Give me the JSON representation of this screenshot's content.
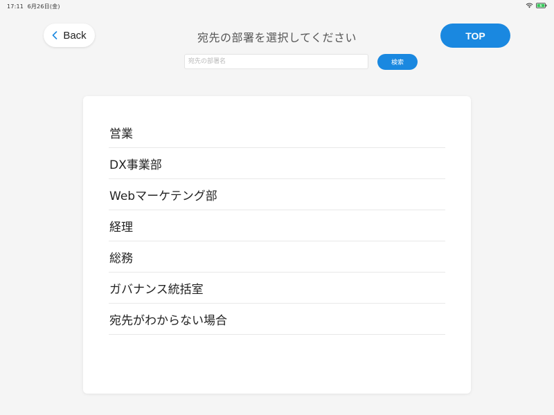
{
  "status_bar": {
    "time": "17:11",
    "date": "6月26日(金)",
    "wifi_icon": "wifi-icon",
    "battery_icon": "battery-charging-icon",
    "battery_color": "#34c759"
  },
  "header": {
    "back_label": "Back",
    "back_icon": "chevron-left-icon",
    "title": "宛先の部署を選択してください",
    "top_label": "TOP"
  },
  "search": {
    "placeholder": "宛先の部署名",
    "value": "",
    "button_label": "検索"
  },
  "departments": [
    {
      "label": "営業"
    },
    {
      "label": "DX事業部"
    },
    {
      "label": "Webマーケテング部"
    },
    {
      "label": "経理"
    },
    {
      "label": "総務"
    },
    {
      "label": "ガバナンス統括室"
    },
    {
      "label": "宛先がわからない場合"
    }
  ],
  "colors": {
    "accent": "#1a88e0",
    "background": "#f5f5f5",
    "card": "#ffffff"
  }
}
